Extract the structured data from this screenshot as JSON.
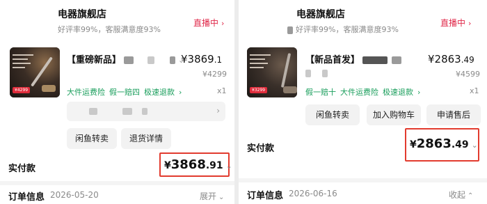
{
  "left": {
    "store_name": "电器旗舰店",
    "store_stats": "好评率99%，客服满意度93%",
    "live_label": "直播中",
    "product_title": "【重磅新品】",
    "price_main": "¥3869",
    "price_cents": ".1",
    "original_price": "¥4299",
    "thumb_tag": "¥4299",
    "quantity": "x1",
    "services": [
      "大件运费险",
      "假一赔四",
      "极速退款"
    ],
    "buttons": [
      "闲鱼转卖",
      "退货详情"
    ],
    "paid_label": "实付款",
    "paid_yen": "¥",
    "paid_int": "3868",
    "paid_cents": ".91",
    "order_title": "订单信息",
    "order_date": "2026-05-20",
    "order_toggle": "展开"
  },
  "right": {
    "store_name": "电器旗舰店",
    "store_stats": "好评率99%，客服满意度93%",
    "live_label": "直播中",
    "product_title": "【新品首发】",
    "price_main": "¥2863",
    "price_cents": ".49",
    "original_price": "¥4599",
    "thumb_tag": "¥3299",
    "quantity": "x1",
    "services": [
      "假一赔十",
      "大件运费险",
      "极速退款"
    ],
    "buttons": [
      "闲鱼转卖",
      "加入购物车",
      "申请售后"
    ],
    "paid_label": "实付款",
    "paid_yen": "¥",
    "paid_int": "2863",
    "paid_cents": ".49",
    "order_title": "订单信息",
    "order_date": "2026-06-16",
    "order_toggle": "收起"
  },
  "colors": {
    "live": "#e0294a",
    "service_green": "#1a9e5c",
    "highlight_box": "#e23b2e"
  },
  "icons": [
    "chevron-right-icon",
    "chevron-down-icon",
    "chevron-up-icon"
  ]
}
